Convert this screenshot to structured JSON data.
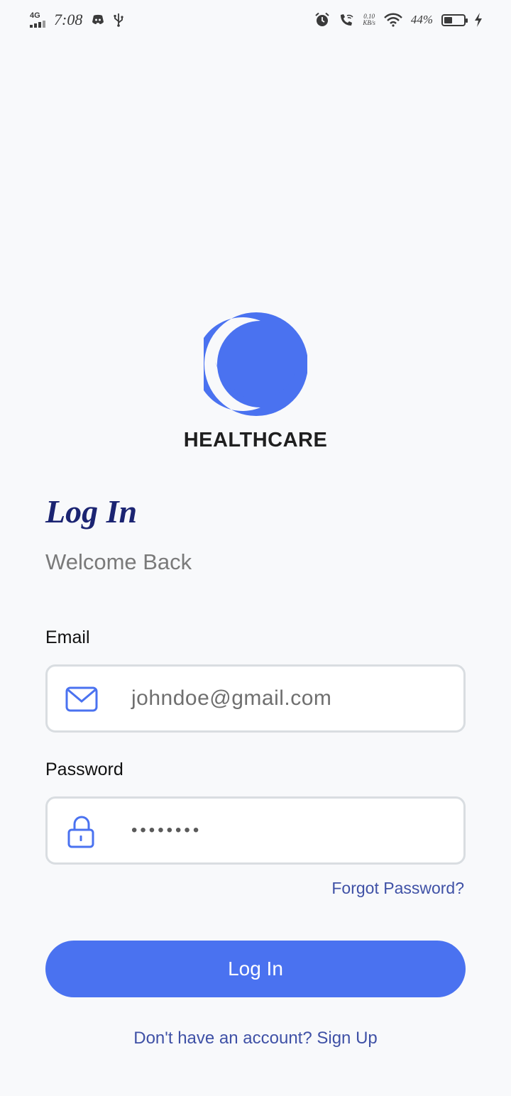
{
  "status_bar": {
    "network": "4G",
    "time": "7:08",
    "speed_value": "0.10",
    "speed_unit": "KB/s",
    "battery_percent": "44%",
    "battery_level": 0.44,
    "icons": [
      "discord-icon",
      "usb-icon",
      "alarm-icon",
      "wifi-call-icon",
      "wifi-icon",
      "battery-icon",
      "charging-icon"
    ]
  },
  "brand": {
    "name": "HEALTHCARE",
    "logo_color": "#4a72f0"
  },
  "login": {
    "title": "Log In",
    "subtitle": "Welcome Back",
    "email_label": "Email",
    "email_value": "johndoe@gmail.com",
    "password_label": "Password",
    "password_value": "••••••••",
    "forgot_password": "Forgot Password?",
    "submit_label": "Log In",
    "signup_prompt": "Don't have an account?",
    "signup_link": "Sign Up"
  },
  "colors": {
    "accent": "#4a72f0",
    "title": "#1b2472",
    "link": "#3f51a6",
    "background": "#f8f9fb"
  }
}
